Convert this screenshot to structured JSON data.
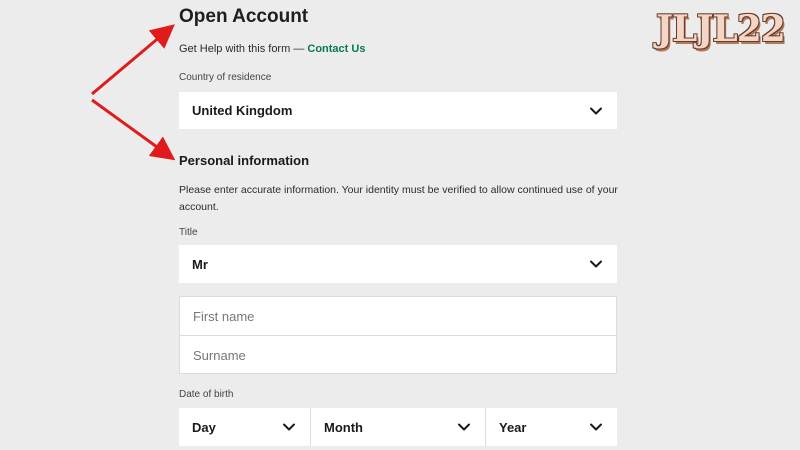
{
  "header": {
    "title": "Open Account",
    "help_text": "Get Help with this form — ",
    "contact_link": "Contact Us"
  },
  "country": {
    "label": "Country of residence",
    "value": "United Kingdom"
  },
  "personal": {
    "heading": "Personal information",
    "description": "Please enter accurate information. Your identity must be verified to allow continued use of your account."
  },
  "title_field": {
    "label": "Title",
    "value": "Mr"
  },
  "name_fields": {
    "first_name_placeholder": "First name",
    "surname_placeholder": "Surname"
  },
  "dob": {
    "label": "Date of birth",
    "day": "Day",
    "month": "Month",
    "year": "Year"
  },
  "logo": {
    "text": "JLJL22"
  },
  "colors": {
    "accent_link": "#0a7a4b",
    "annotation_arrow": "#e01b1b",
    "background": "#ececec"
  },
  "icons": {
    "dropdown": "chevron-down-icon",
    "annotation": "red-arrow"
  }
}
